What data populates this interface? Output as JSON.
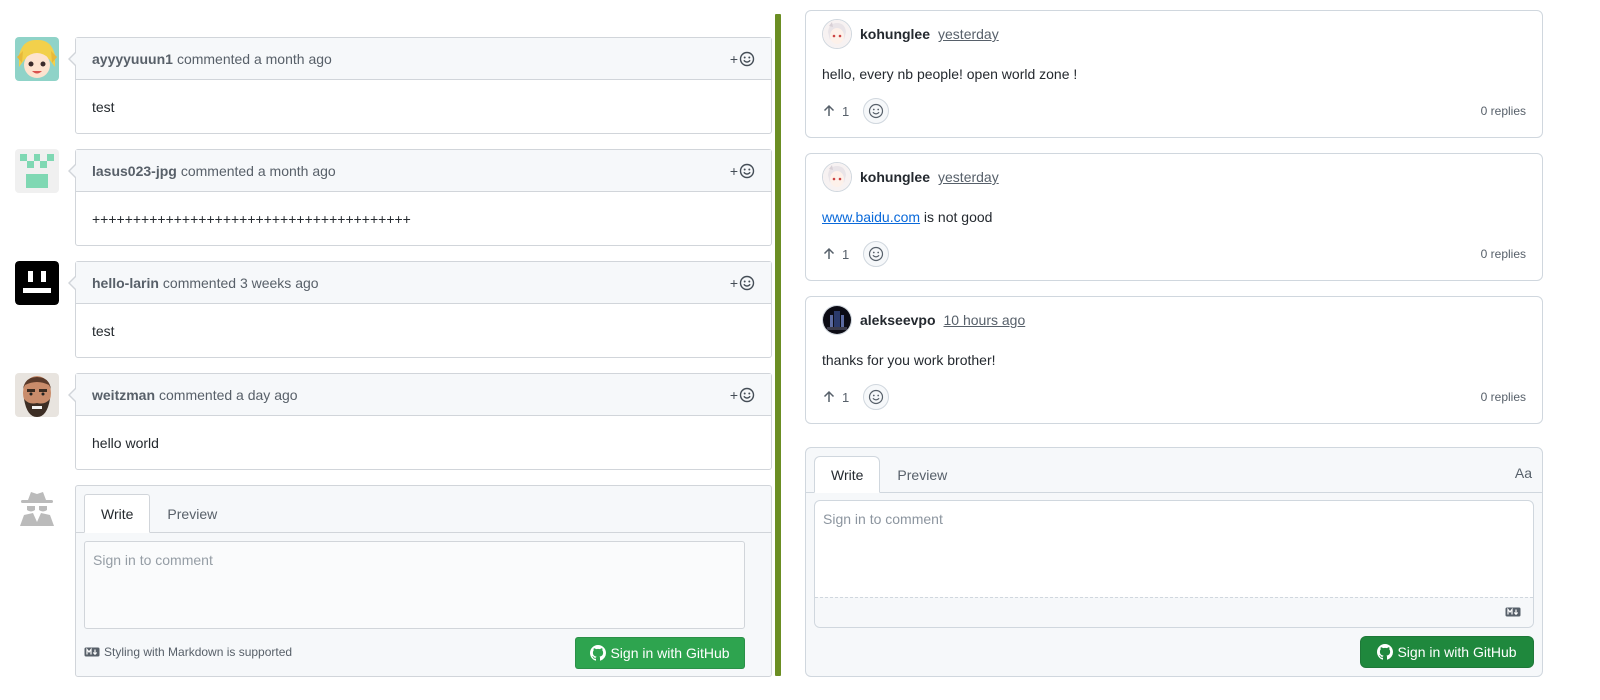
{
  "left_thread": {
    "comments": [
      {
        "author": "ayyyyuuun1",
        "action": "commented a month ago",
        "reaction": "+",
        "body": "test"
      },
      {
        "author": "lasus023-jpg",
        "action": "commented a month ago",
        "reaction": "+",
        "body": "+++++++++++++++++++++++++++++++++++++++"
      },
      {
        "author": "hello-larin",
        "action": "commented 3 weeks ago",
        "reaction": "+",
        "body": "test"
      },
      {
        "author": "weitzman",
        "action": "commented a day ago",
        "reaction": "+",
        "body": "hello world"
      }
    ],
    "new_comment": {
      "tab_write": "Write",
      "tab_preview": "Preview",
      "placeholder": "Sign in to comment",
      "markdown_note": "Styling with Markdown is supported",
      "signin_label": "Sign in with GitHub"
    }
  },
  "right_thread": {
    "comments": [
      {
        "author": "kohunglee",
        "time": "yesterday",
        "body": "hello, every nb people! open world zone !",
        "upvotes": "1",
        "replies": "0 replies"
      },
      {
        "author": "kohunglee",
        "time": "yesterday",
        "link_text": "www.baidu.com",
        "body_suffix": " is not good",
        "upvotes": "1",
        "replies": "0 replies"
      },
      {
        "author": "alekseevpo",
        "time": "10 hours ago",
        "body": "thanks for you work brother!",
        "upvotes": "1",
        "replies": "0 replies"
      }
    ],
    "new_comment": {
      "tab_write": "Write",
      "tab_preview": "Preview",
      "font_toggle": "Aa",
      "placeholder": "Sign in to comment",
      "signin_label": "Sign in with GitHub"
    }
  },
  "colors": {
    "divider": "#6b8e23",
    "button_green_left": "#2ea44f",
    "button_green_right": "#1f883d",
    "link": "#0969da"
  }
}
